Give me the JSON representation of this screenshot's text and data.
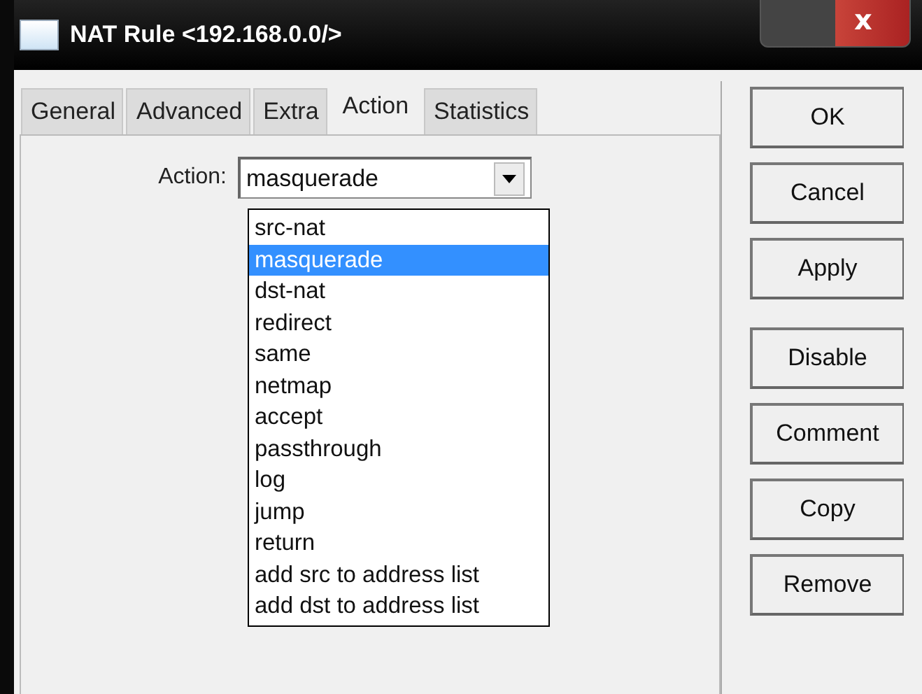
{
  "window": {
    "title": "NAT Rule <192.168.0.0/>",
    "close": "x"
  },
  "tabs": [
    {
      "label": "General",
      "selected": false
    },
    {
      "label": "Advanced",
      "selected": false
    },
    {
      "label": "Extra",
      "selected": false
    },
    {
      "label": "Action",
      "selected": true
    },
    {
      "label": "Statistics",
      "selected": false
    }
  ],
  "action": {
    "label": "Action:",
    "value": "masquerade",
    "expanded": true,
    "options": [
      {
        "label": "src-nat",
        "selected": false
      },
      {
        "label": "masquerade",
        "selected": true
      },
      {
        "label": "dst-nat",
        "selected": false
      },
      {
        "label": "redirect",
        "selected": false
      },
      {
        "label": "same",
        "selected": false
      },
      {
        "label": "netmap",
        "selected": false
      },
      {
        "label": "accept",
        "selected": false
      },
      {
        "label": "passthrough",
        "selected": false
      },
      {
        "label": "log",
        "selected": false
      },
      {
        "label": "jump",
        "selected": false
      },
      {
        "label": "return",
        "selected": false
      },
      {
        "label": "add src to address list",
        "selected": false
      },
      {
        "label": "add dst to address list",
        "selected": false
      }
    ]
  },
  "button_groups": [
    [
      "OK",
      "Cancel",
      "Apply"
    ],
    [
      "Disable",
      "Comment",
      "Copy",
      "Remove"
    ]
  ]
}
